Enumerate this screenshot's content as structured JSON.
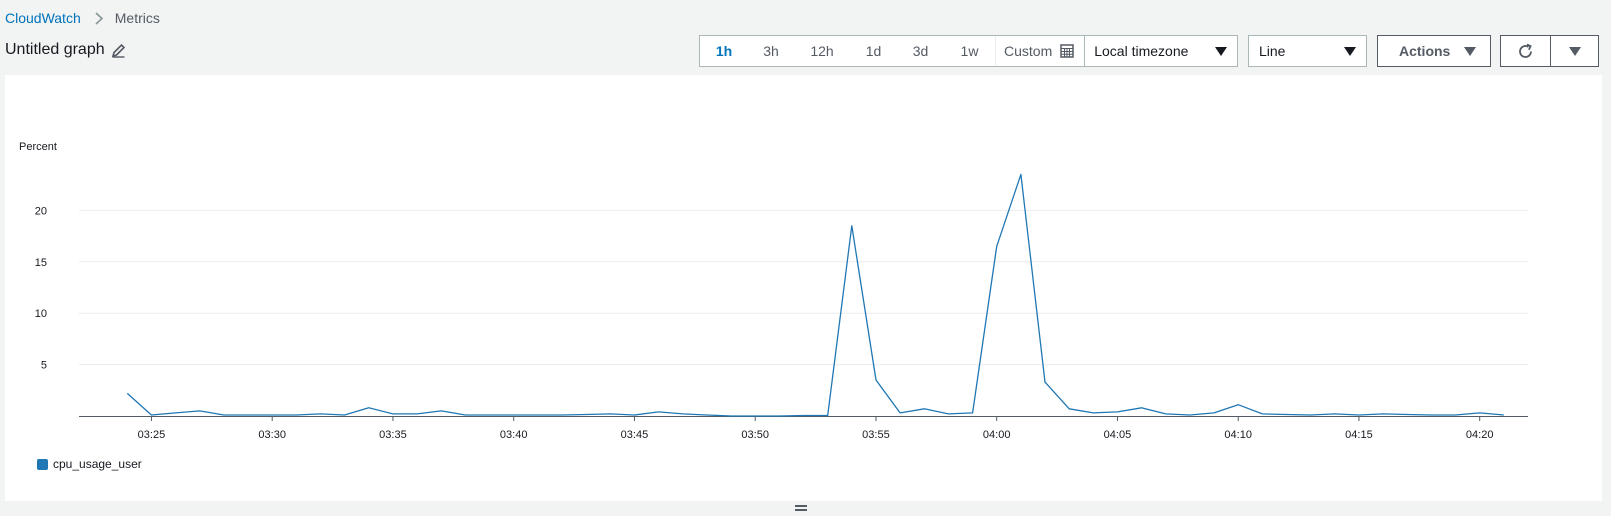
{
  "breadcrumb": {
    "root": "CloudWatch",
    "current": "Metrics"
  },
  "graph": {
    "title": "Untitled graph"
  },
  "toolbar": {
    "periods": [
      "1h",
      "3h",
      "12h",
      "1d",
      "3d",
      "1w"
    ],
    "active_period": "1h",
    "custom_label": "Custom",
    "timezone_label": "Local timezone",
    "view_type": "Line",
    "actions_label": "Actions"
  },
  "colors": {
    "accent": "#0073bb",
    "series": "#1f77b4",
    "grid": "#e9ebed",
    "axis": "#545b64"
  },
  "chart_data": {
    "type": "line",
    "ylabel": "Percent",
    "ylim": [
      0,
      25
    ],
    "yticks": [
      5,
      10,
      15,
      20
    ],
    "grid": true,
    "legend": "bottom-left",
    "x_start": "03:22",
    "x_end": "04:22",
    "x_ticks": [
      "03:25",
      "03:30",
      "03:35",
      "03:40",
      "03:45",
      "03:50",
      "03:55",
      "04:00",
      "04:05",
      "04:10",
      "04:15",
      "04:20"
    ],
    "series": [
      {
        "name": "cpu_usage_user",
        "color": "#1f77b4",
        "x": [
          "03:24",
          "03:25",
          "03:26",
          "03:27",
          "03:28",
          "03:29",
          "03:30",
          "03:31",
          "03:32",
          "03:33",
          "03:34",
          "03:35",
          "03:36",
          "03:37",
          "03:38",
          "03:39",
          "03:40",
          "03:41",
          "03:42",
          "03:43",
          "03:44",
          "03:45",
          "03:46",
          "03:47",
          "03:48",
          "03:49",
          "03:50",
          "03:51",
          "03:52",
          "03:53",
          "03:54",
          "03:55",
          "03:56",
          "03:57",
          "03:58",
          "03:59",
          "04:00",
          "04:01",
          "04:02",
          "04:03",
          "04:04",
          "04:05",
          "04:06",
          "04:07",
          "04:08",
          "04:09",
          "04:10",
          "04:11",
          "04:12",
          "04:13",
          "04:14",
          "04:15",
          "04:16",
          "04:17",
          "04:18",
          "04:19",
          "04:20",
          "04:21"
        ],
        "values": [
          2.2,
          0.1,
          0.3,
          0.5,
          0.1,
          0.1,
          0.1,
          0.1,
          0.2,
          0.1,
          0.8,
          0.2,
          0.2,
          0.5,
          0.1,
          0.1,
          0.1,
          0.1,
          0.1,
          0.15,
          0.2,
          0.1,
          0.4,
          0.2,
          0.1,
          0.0,
          0.0,
          0.0,
          0.05,
          0.05,
          18.5,
          3.5,
          0.3,
          0.7,
          0.2,
          0.3,
          16.5,
          23.5,
          3.3,
          0.7,
          0.3,
          0.4,
          0.8,
          0.2,
          0.1,
          0.3,
          1.1,
          0.2,
          0.15,
          0.1,
          0.2,
          0.1,
          0.2,
          0.15,
          0.1,
          0.1,
          0.3,
          0.1
        ]
      }
    ]
  }
}
